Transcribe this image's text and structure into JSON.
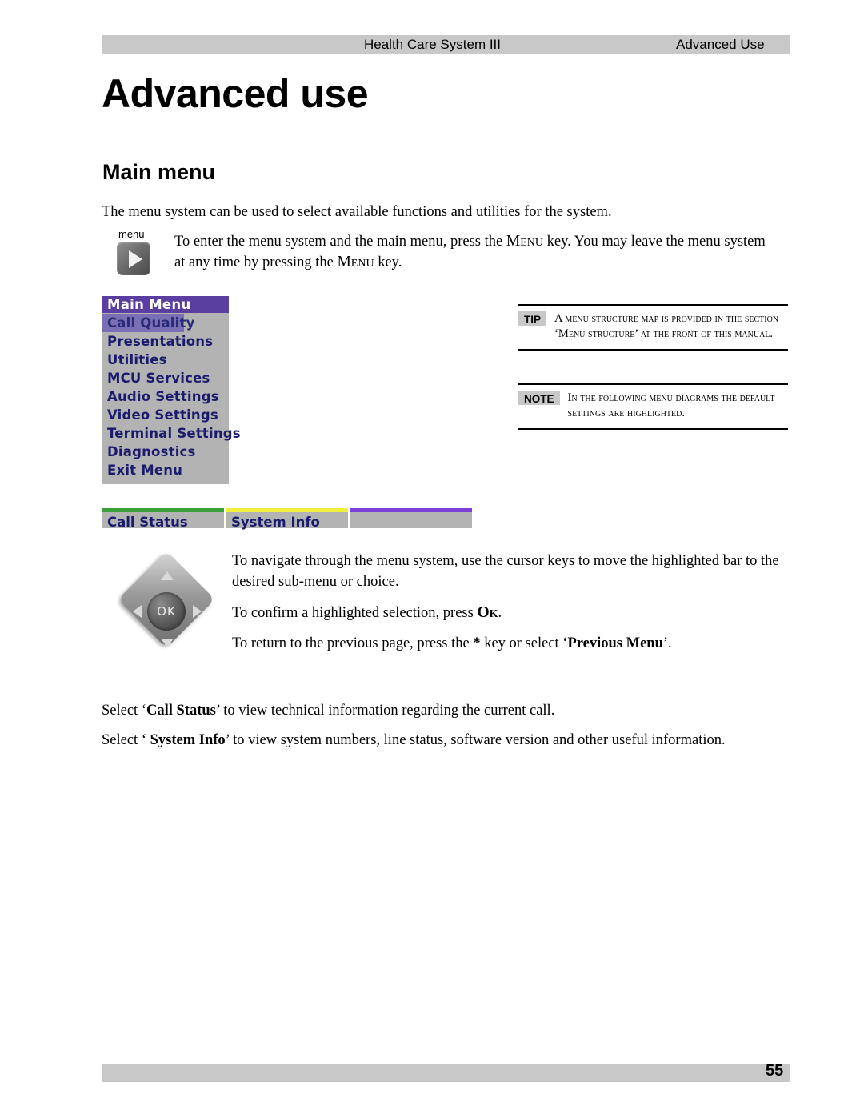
{
  "header": {
    "title": "Health Care System III",
    "section": "Advanced Use"
  },
  "page_title": "Advanced use",
  "section_heading": "Main menu",
  "paragraphs": {
    "intro": "The menu system can be used to select available functions and utilities for the system.",
    "menu_key_1": "To enter the menu system and the main menu, press the ",
    "menu_key_sc1": "Menu",
    "menu_key_2": " key. You may leave the menu system at any time by pressing the ",
    "menu_key_sc2": "Menu",
    "menu_key_3": " key.",
    "navigate": "To navigate through the menu system, use the cursor keys to move the highlighted bar to the desired sub-menu or choice.",
    "confirm_1": "To confirm a highlighted selection, press ",
    "confirm_ok": "Ok",
    "confirm_2": ".",
    "previous_1": "To return to the previous page, press the ",
    "previous_star": "*",
    "previous_2": " key or select ‘",
    "previous_bold": "Previous Menu",
    "previous_3": "’.",
    "call_status_1": "Select ‘",
    "call_status_bold": "Call Status",
    "call_status_2": "’ to view technical information regarding the current call.",
    "system_info_1": "Select ‘ ",
    "system_info_bold": "System Info",
    "system_info_2": "’ to view system numbers, line status, software version and other useful information."
  },
  "menu_key_icon": {
    "label": "menu"
  },
  "main_menu_screen": {
    "title": "Main Menu",
    "items": [
      {
        "label": "Call Quality",
        "selected": true
      },
      {
        "label": "Presentations",
        "selected": false
      },
      {
        "label": "Utilities",
        "selected": false
      },
      {
        "label": "MCU Services",
        "selected": false
      },
      {
        "label": "Audio Settings",
        "selected": false
      },
      {
        "label": "Video Settings",
        "selected": false
      },
      {
        "label": "Terminal Settings",
        "selected": false
      },
      {
        "label": "Diagnostics",
        "selected": false
      },
      {
        "label": "Exit Menu",
        "selected": false
      }
    ],
    "tabs": [
      {
        "label": "Call Status",
        "accent": "#3aa03a"
      },
      {
        "label": "System Info",
        "accent": "#f0f03c"
      },
      {
        "label": "",
        "accent": "#7d3fd8"
      }
    ]
  },
  "callouts": {
    "tip": {
      "badge": "TIP",
      "text": "A menu structure map is provided in the section ‘Menu structure’ at the front of this manual."
    },
    "note": {
      "badge": "NOTE",
      "text": "In the following menu diagrams the default settings are highlighted."
    }
  },
  "navpad": {
    "ok_label": "OK"
  },
  "footer": {
    "page_number": "55"
  }
}
